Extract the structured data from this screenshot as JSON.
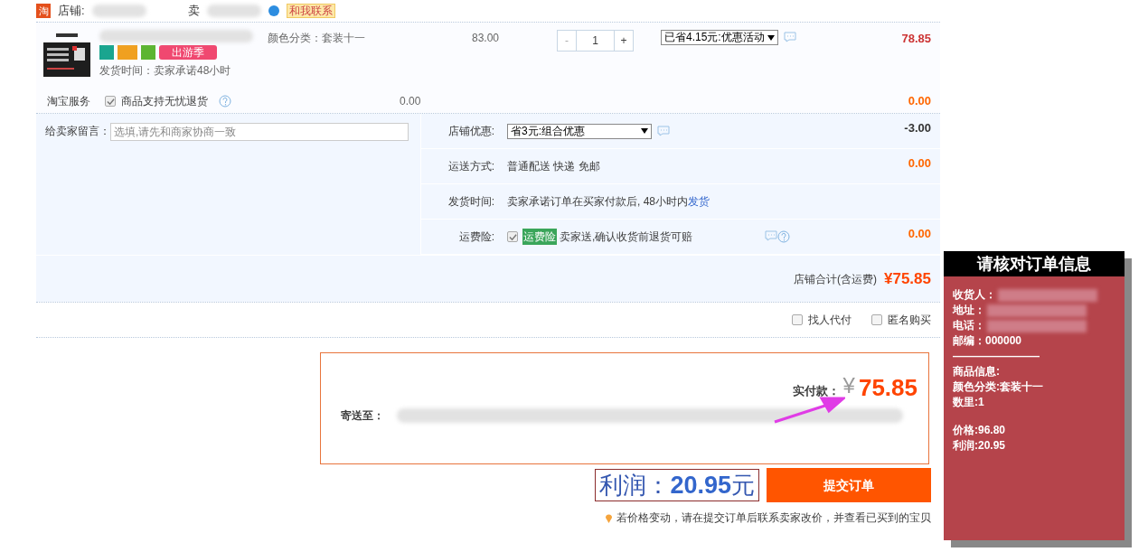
{
  "shop_header": {
    "logo": "淘",
    "shop_label": "店铺:",
    "seller_label": "卖",
    "contact": "和我联系"
  },
  "item": {
    "spec": "颜色分类：套装十一",
    "price": "83.00",
    "quantity": "1",
    "minus": "-",
    "plus": "+",
    "promo": "已省4.15元:优惠活动",
    "subtotal": "78.85",
    "tag": "出游季",
    "ship_time": "发货时间：卖家承诺48小时"
  },
  "service": {
    "label": "淘宝服务",
    "option": "商品支持无忧退货",
    "checked": true,
    "price": "0.00",
    "subtotal": "0.00"
  },
  "message": {
    "label": "给卖家留言：",
    "placeholder": "选填,请先和商家协商一致"
  },
  "options": [
    {
      "kind": "select",
      "label": "店铺优惠:",
      "value": "省3元:组合优惠",
      "amount": "-3.00"
    },
    {
      "kind": "text",
      "label": "运送方式:",
      "value": "普通配送 快递 免邮",
      "amount": "0.00"
    },
    {
      "kind": "link",
      "label": "发货时间:",
      "value": "卖家承诺订单在买家付款后, 48小时内",
      "link": "发货"
    },
    {
      "kind": "insurance",
      "label": "运费险:",
      "checked": true,
      "tag": "运费险",
      "value": "卖家送,确认收货前退货可赔",
      "amount": "0.00"
    }
  ],
  "shop_total": {
    "label": "店铺合计(含运费)",
    "value": "¥75.85"
  },
  "extras": [
    {
      "label": "找人代付",
      "checked": false
    },
    {
      "label": "匿名购买",
      "checked": false
    }
  ],
  "payment": {
    "label": "实付款：",
    "currency": "¥",
    "value": "75.85",
    "address_label": "寄送至："
  },
  "profit": {
    "label": "利润：",
    "value": "20.95",
    "unit": "元"
  },
  "submit": "提交订单",
  "notice": "若价格变动，请在提交订单后联系卖家改价，并查看已买到的宝贝",
  "check_panel": {
    "title": "请核对订单信息",
    "lines": [
      {
        "kind": "blurred",
        "text": "收货人："
      },
      {
        "kind": "blurred",
        "text": "地址："
      },
      {
        "kind": "blurred",
        "text": "电话："
      },
      {
        "kind": "plain",
        "text": "邮编：000000"
      },
      {
        "kind": "plain",
        "text": "————————"
      },
      {
        "kind": "plain",
        "text": "商品信息:"
      },
      {
        "kind": "plain",
        "text": "颜色分类:套装十一"
      },
      {
        "kind": "plain",
        "text": "数里:1"
      },
      {
        "kind": "gap"
      },
      {
        "kind": "plain",
        "text": "价格:96.80"
      },
      {
        "kind": "plain",
        "text": "利润:20.95"
      }
    ]
  }
}
